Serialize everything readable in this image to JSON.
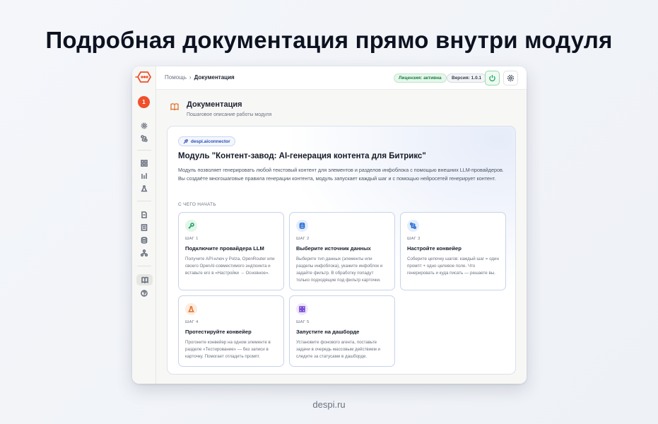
{
  "hero_title": "Подробная документация прямо внутри модуля",
  "footer": "despi.ru",
  "sidebar": {
    "avatar_text": "1",
    "icons": [
      "gear-icon",
      "route-icon",
      "grid-icon",
      "chart-icon",
      "flask-icon",
      "file-icon",
      "list-icon",
      "database-icon",
      "network-icon",
      "book-icon",
      "help-icon"
    ]
  },
  "topbar": {
    "breadcrumb_root": "Помощь",
    "breadcrumb_sep": "›",
    "breadcrumb_current": "Документация",
    "license_badge": "Лицензия: активна",
    "version_badge": "Версия: 1.0.1"
  },
  "page": {
    "title": "Документация",
    "subtitle": "Пошаговое описание работы модуля"
  },
  "panel": {
    "chip": "despi.aiconnector",
    "title": "Модуль \"Контент-завод: AI-генерация контента для Битрикс\"",
    "description": "Модуль позволяет генерировать любой текстовый контент для элементов и разделов инфоблока с помощью внешних LLM-провайдеров. Вы создаёте многошаговые правила генерации контента, модуль запускает каждый шаг и с помощью нейросетей генерирует контент.",
    "start_label": "С ЧЕГО НАЧАТЬ",
    "steps": [
      {
        "icon": "key-icon",
        "num": "ШАГ 1",
        "name": "Подключите провайдера LLM",
        "text": "Получите API-ключ у Polza, OpenRouter или своего OpenAI-совместимого эндпоинта и вставьте его в «Настройки → Основное»."
      },
      {
        "icon": "database-icon",
        "num": "ШАГ 2",
        "name": "Выберите источник данных",
        "text": "Выберите тип данных (элементы или разделы инфоблока), укажите инфоблок и задайте фильтр. В обработку попадут только подходящие под фильтр карточки."
      },
      {
        "icon": "route-icon",
        "num": "ШАГ 3",
        "name": "Настройте конвейер",
        "text": "Соберите цепочку шагов: каждый шаг = один промпт + одно целевое поле. Что генерировать и куда писать — решаете вы."
      },
      {
        "icon": "flask-icon",
        "num": "ШАГ 4",
        "name": "Протестируйте конвейер",
        "text": "Прогоните конвейер на одном элементе в разделе «Тестирование» — без записи в карточку. Помогает отладить промпт."
      },
      {
        "icon": "grid-icon",
        "num": "ШАГ 5",
        "name": "Запустите на дашборде",
        "text": "Установите фонового агента, поставьте задачи в очередь массовым действием и следите за статусами в дашборде."
      }
    ]
  },
  "colors": {
    "accent_orange": "#f0502b",
    "step1": "#21a366",
    "step2": "#2b6fd6",
    "step3": "#2b6fd6",
    "step4": "#e0732c",
    "step5": "#7b4fd6"
  }
}
